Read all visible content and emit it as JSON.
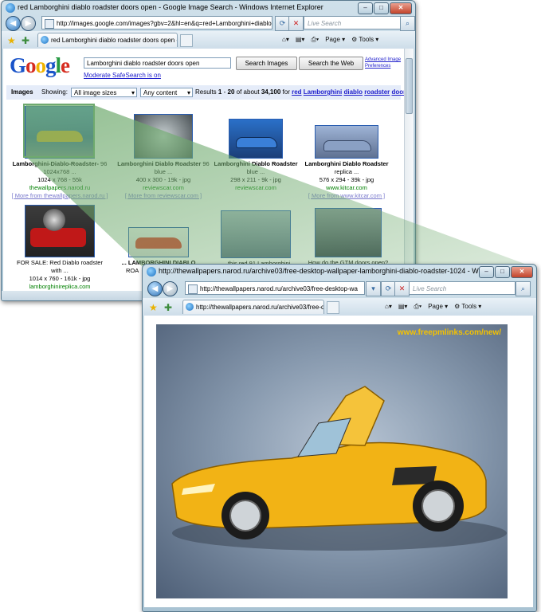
{
  "back_window": {
    "title": "red Lamborghini diablo roadster doors open - Google Image Search - Windows Internet Explorer",
    "address": "http://images.google.com/images?gbv=2&hl=en&q=red+Lamborghini+diablo+roac",
    "search_placeholder": "Live Search",
    "tab_label": "red Lamborghini diablo roadster doors open - Go...",
    "toolbar": {
      "page": "Page",
      "tools": "Tools"
    }
  },
  "google": {
    "logo": "Google",
    "query": "Lamborghini diablo roadster doors open",
    "search_images": "Search Images",
    "search_web": "Search the Web",
    "advanced": "Advanced Image",
    "preferences": "Preferences",
    "safesearch": "Moderate SafeSearch is on",
    "images_label": "Images",
    "showing_label": "Showing:",
    "size_filter": "All image sizes",
    "content_filter": "Any content",
    "results_prefix": "Results",
    "results_range_start": "1",
    "results_dash": "-",
    "results_range_end": "20",
    "results_of": "of about",
    "results_count": "34,100",
    "results_for": "for",
    "query_terms": [
      "red",
      "Lamborghini",
      "diablo",
      "roadster",
      "doors",
      "op"
    ]
  },
  "results": [
    {
      "title": "Lamborghini-Diablo-Roadster-",
      "suffix": "96",
      "line2": "1024x768 ...",
      "meta": "1024 x 768 - 55k",
      "site": "thewallpapers.narod.ru",
      "more": "[ More from thewallpapers.narod.ru ]",
      "color": "#1c6ac0"
    },
    {
      "title": "Lamborghini Diablo Roadster",
      "suffix": "96",
      "line2": "blue ...",
      "meta": "400 x 300 - 19k - jpg",
      "site": "reviewscar.com",
      "more": "[ More from reviewscar.com ]",
      "color": "#6c7a80"
    },
    {
      "title": "Lamborghini Diablo Roadster",
      "suffix": "",
      "line2": "blue ...",
      "meta": "298 x 211 - 9k - jpg",
      "site": "reviewscar.com",
      "more": "",
      "color": "#2a66b8"
    },
    {
      "title": "Lamborghini Diablo Roadster",
      "suffix": "",
      "line2": "replica ...",
      "meta": "576 x 294 - 39k - jpg",
      "site": "www.kitcar.com",
      "more": "[ More from www.kitcar.com ]",
      "color": "#7a92b8"
    },
    {
      "title": "FOR SALE: Red Diablo roadster",
      "suffix": "",
      "line2": "with ...",
      "meta": "1014 x 760 - 161k - jpg",
      "site": "lamborghinireplica.com",
      "more": "",
      "color": "#b52020"
    },
    {
      "title": "... LAMBORGHINI DIABLO",
      "suffix": "",
      "line2": "ROA",
      "meta": "500 x",
      "site": "www",
      "more": "",
      "color": "#d83a2a"
    },
    {
      "title": "... this red 91 Lamborghini",
      "suffix": "",
      "line2": "",
      "meta": "",
      "site": "",
      "more": "",
      "color": "#6a8a9c"
    },
    {
      "title": "How do the GTM doors open?",
      "suffix": "",
      "line2": "",
      "meta": "",
      "site": "",
      "more": "",
      "color": "#5c6c74"
    }
  ],
  "front_window": {
    "title": "http://thewallpapers.narod.ru/archive03/free-desktop-wallpaper-lamborghini-diablo-roadster-1024 - Windows I...",
    "address": "http://thewallpapers.narod.ru/archive03/free-desktop-wa",
    "search_placeholder": "Live Search",
    "tab_label": "http://thewallpapers.narod.ru/archive03/free-des...",
    "toolbar": {
      "page": "Page",
      "tools": "Tools"
    },
    "wallpaper_watermark": "www.freepmlinks.com/new/"
  },
  "colors": {
    "car": "#f2b315",
    "zoom_wedge": "#6faa6e"
  }
}
